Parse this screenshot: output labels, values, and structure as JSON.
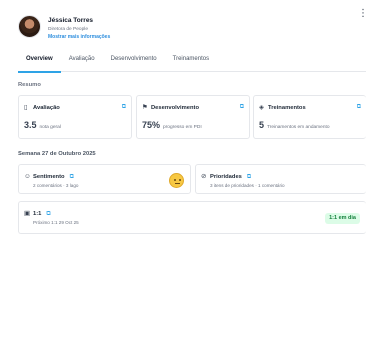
{
  "profile": {
    "name": "Jéssica Torres",
    "role": "Diretora de People",
    "link": "Mostrar mais informações"
  },
  "tabs": [
    {
      "label": "Overview",
      "active": true
    },
    {
      "label": "Avaliação",
      "active": false
    },
    {
      "label": "Desenvolvimento",
      "active": false
    },
    {
      "label": "Treinamentos",
      "active": false
    }
  ],
  "resumo": {
    "title": "Resumo",
    "cards": [
      {
        "title": "Avaliação",
        "icon": "clipboard-icon",
        "value": "3.5",
        "label": "nota geral"
      },
      {
        "title": "Desenvolvimento",
        "icon": "flag-icon",
        "value": "75%",
        "label": "progresso em PDI"
      },
      {
        "title": "Treinamentos",
        "icon": "graduation-cap-icon",
        "value": "5",
        "label": "Treinamentos em andamento"
      }
    ]
  },
  "week": {
    "title": "Semana 27 de Outubro 2025",
    "sentimento": {
      "title": "Sentimento",
      "icon": "smile-icon",
      "sub": "2 comentários · 3 lago"
    },
    "prioridades": {
      "title": "Prioridades",
      "icon": "check-circle-icon",
      "sub": "3 itens de prioridades · 1 comentário"
    },
    "one_on_one": {
      "title": "1:1",
      "icon": "chat-bubbles-icon",
      "sub": "Próximo 1:1 29 Oct 25",
      "badge": "1:1 em dia"
    }
  },
  "colors": {
    "accent": "#2ea3e6",
    "badge_bg": "#dcfce7",
    "badge_text": "#15803d"
  }
}
